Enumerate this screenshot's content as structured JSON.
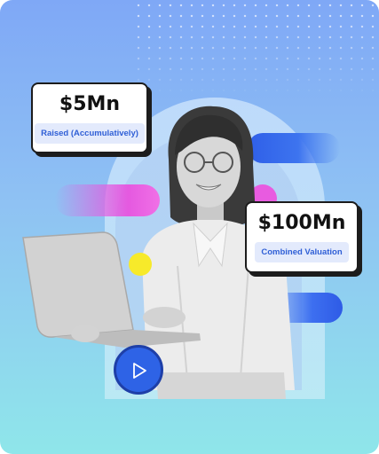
{
  "stats": [
    {
      "value": "$5Mn",
      "label": "Raised (Accumulatively)"
    },
    {
      "value": "$100Mn",
      "label": "Combined Valuation"
    }
  ],
  "icons": {
    "play": "play-icon"
  },
  "colors": {
    "accent_blue": "#2e63e6",
    "accent_pink": "#e559e0",
    "accent_yellow": "#f7ea2a",
    "label_bg": "#e3eafc",
    "label_text": "#2f5fd6"
  }
}
